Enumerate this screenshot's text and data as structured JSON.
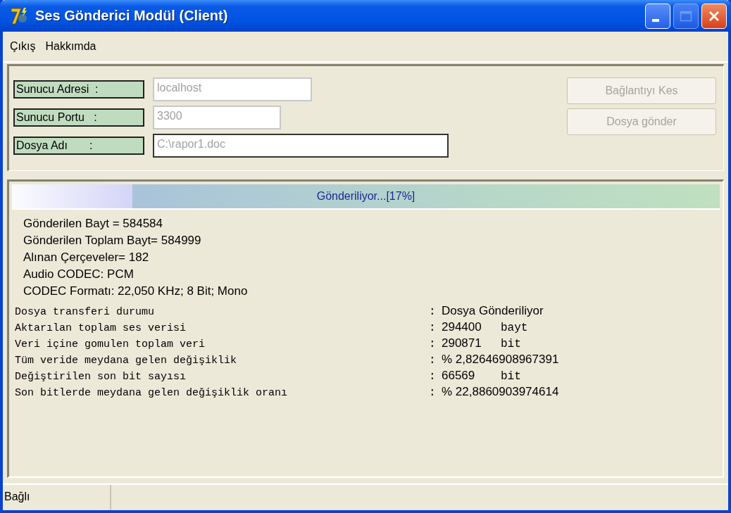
{
  "window": {
    "title": "Ses Gönderici Modül (Client)"
  },
  "menu": [
    "Çıkış",
    "Hakkımda"
  ],
  "fields": [
    {
      "label": "Sunucu Adresi  :",
      "value": "localhost",
      "disabled": true,
      "focused": false
    },
    {
      "label": "Sunucu Portu   :",
      "value": "3300",
      "disabled": true,
      "focused": false
    },
    {
      "label": "Dosya Adı       :",
      "value": "C:\\rapor1.doc",
      "disabled": true,
      "focused": true
    }
  ],
  "buttons": [
    {
      "label": "Bağlantıyı Kes",
      "disabled": true
    },
    {
      "label": "Dosya gönder",
      "disabled": true
    }
  ],
  "progress": {
    "label": "Gönderiliyor...[17%]",
    "level": 0.17
  },
  "stats": [
    "Gönderilen Bayt = 584584",
    "Gönderilen Toplam Bayt= 584999",
    "Alınan Çerçeveler= 182",
    "Audio CODEC: PCM",
    "CODEC Formatı: 22,050 KHz; 8 Bit; Mono"
  ],
  "details": [
    {
      "label": "Dosya transferi durumu",
      "separator": ":",
      "value": "Dosya Gönderiliyor"
    },
    {
      "label": "Aktarılan toplam ses verisi",
      "separator": ":",
      "value": "294400",
      "unit": "bayt"
    },
    {
      "label": "Veri içine gomulen toplam veri",
      "separator": ":",
      "value": "290871",
      "unit": "bit"
    },
    {
      "label": "Tüm veride meydana gelen değişiklik",
      "separator": ":",
      "value": "% 2,82646908967391"
    },
    {
      "label": "Değiştirilen son bit sayısı",
      "separator": ":",
      "value": "66569",
      "unit": "bit"
    },
    {
      "label": "Son bitlerde meydana gelen değişiklik oranı",
      "separator": ":",
      "value": "% 22,8860903974614"
    }
  ],
  "status_bar": [
    "Bağlı"
  ]
}
